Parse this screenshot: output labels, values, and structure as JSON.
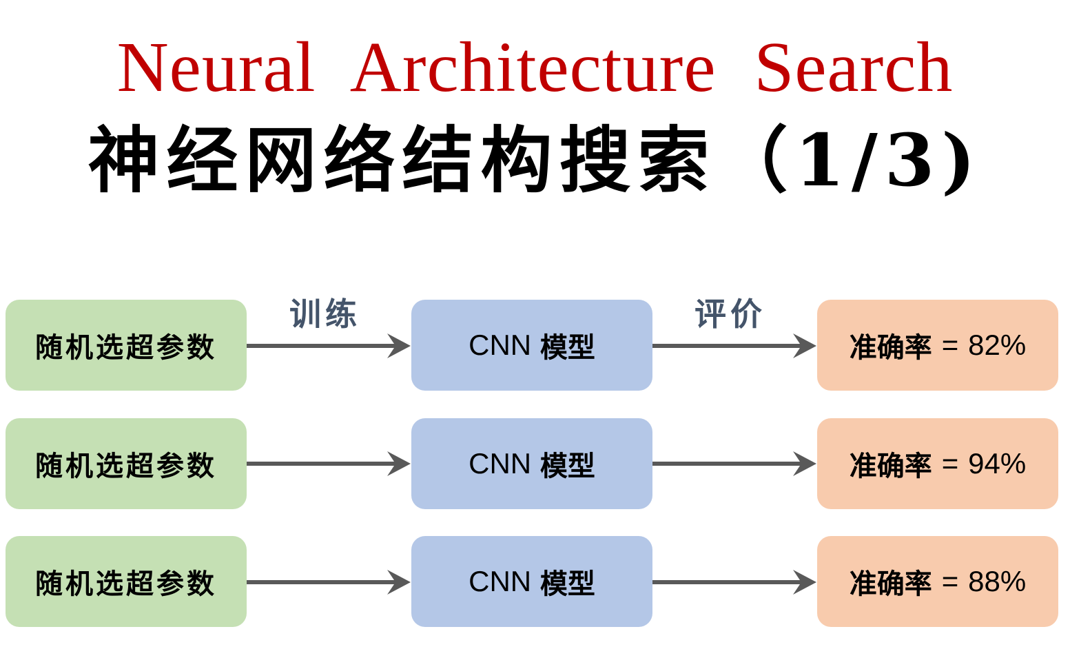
{
  "title": {
    "english": "Neural Architecture Search",
    "chinese": "神经网络结构搜索（1/3)"
  },
  "edge_labels": {
    "train": "训练",
    "evaluate": "评价"
  },
  "rows": [
    {
      "input": "随机选超参数",
      "model_prefix": "CNN",
      "model": "模型",
      "metric": "准确率",
      "equals": "=",
      "value": "82%"
    },
    {
      "input": "随机选超参数",
      "model_prefix": "CNN",
      "model": "模型",
      "metric": "准确率",
      "equals": "=",
      "value": "94%"
    },
    {
      "input": "随机选超参数",
      "model_prefix": "CNN",
      "model": "模型",
      "metric": "准确率",
      "equals": "=",
      "value": "88%"
    }
  ],
  "colors": {
    "title_red": "#c00000",
    "green_box": "#c5e0b4",
    "blue_box": "#b4c7e7",
    "orange_box": "#f8cbad",
    "arrow": "#595959",
    "label": "#44546a"
  }
}
